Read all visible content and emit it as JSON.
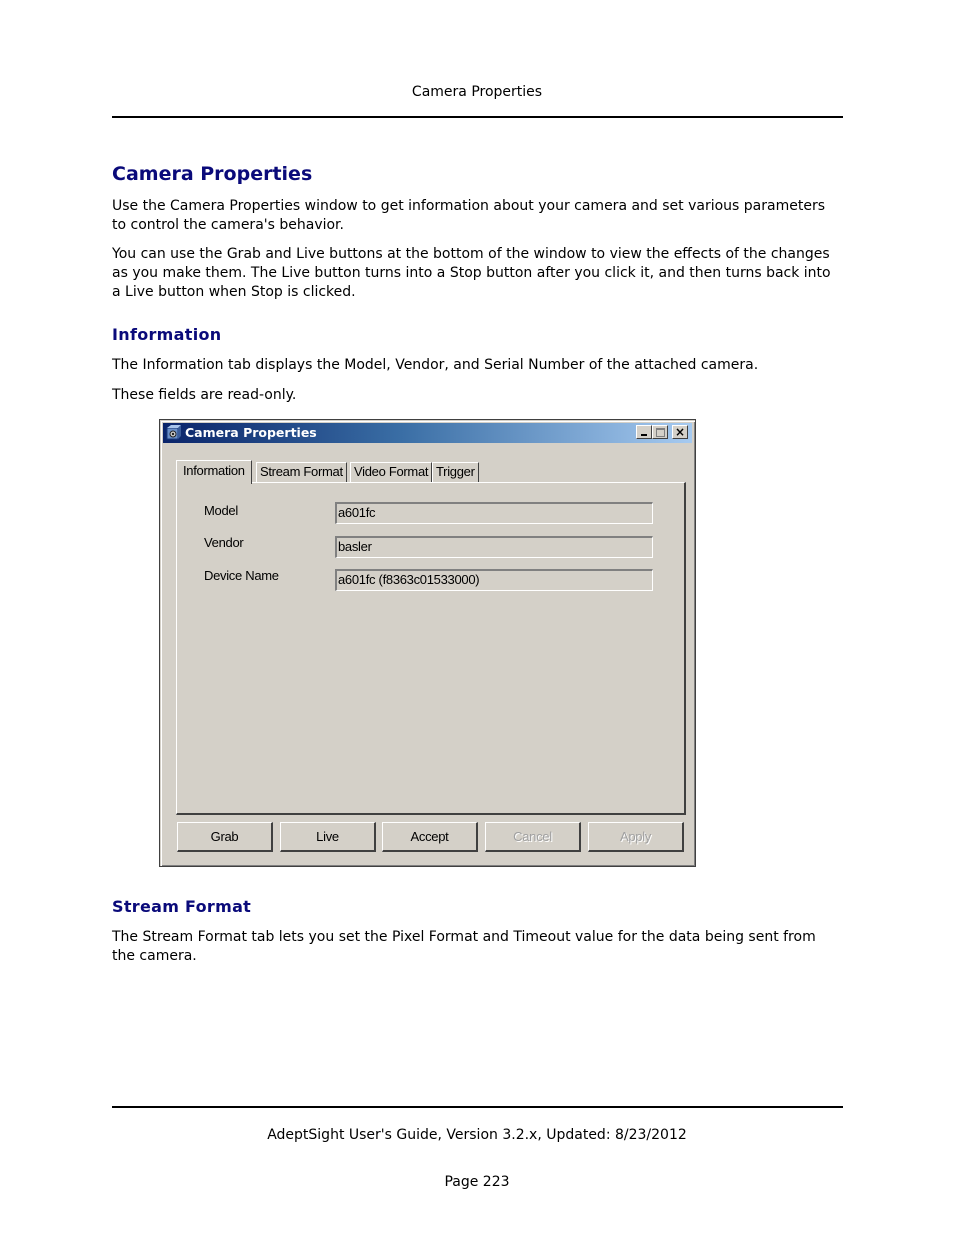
{
  "page": {
    "running_head": "Camera Properties",
    "title": "Camera Properties",
    "intro_paragraphs": [
      "Use the Camera Properties window to get information about your camera and set various parameters to control the camera's behavior.",
      "You can use the Grab and Live buttons at the bottom of the window to view the effects of the changes as you make them. The Live button turns into a Stop button after you click it, and then turns back into a Live button when Stop is clicked."
    ],
    "sections": [
      {
        "heading": "Information",
        "paragraphs": [
          "The Information tab displays the Model, Vendor, and Serial Number of the attached camera.",
          "These fields are read-only."
        ]
      },
      {
        "heading": "Stream Format",
        "paragraphs": [
          "The Stream Format tab lets you set the Pixel Format and Timeout value for the data being sent from the camera."
        ]
      }
    ],
    "footer": {
      "guide": "AdeptSight User's Guide,  Version 3.2.x, Updated: 8/23/2012",
      "page": "Page 223"
    }
  },
  "window": {
    "title": "Camera Properties",
    "icon": "camera-icon",
    "controls": {
      "minimize": "minimize-icon",
      "maximize": "maximize-icon",
      "close": "×"
    },
    "tabs": [
      {
        "label": "Information",
        "active": true
      },
      {
        "label": "Stream Format",
        "active": false
      },
      {
        "label": "Video Format",
        "active": false
      },
      {
        "label": "Trigger",
        "active": false
      }
    ],
    "fields": [
      {
        "label": "Model",
        "value": "a601fc"
      },
      {
        "label": "Vendor",
        "value": "basler"
      },
      {
        "label": "Device Name",
        "value": "a601fc (f8363c01533000)"
      }
    ],
    "buttons": [
      {
        "label": "Grab",
        "enabled": true
      },
      {
        "label": "Live",
        "enabled": true
      },
      {
        "label": "Accept",
        "enabled": true
      },
      {
        "label": "Cancel",
        "enabled": false
      },
      {
        "label": "Apply",
        "enabled": false
      }
    ]
  }
}
